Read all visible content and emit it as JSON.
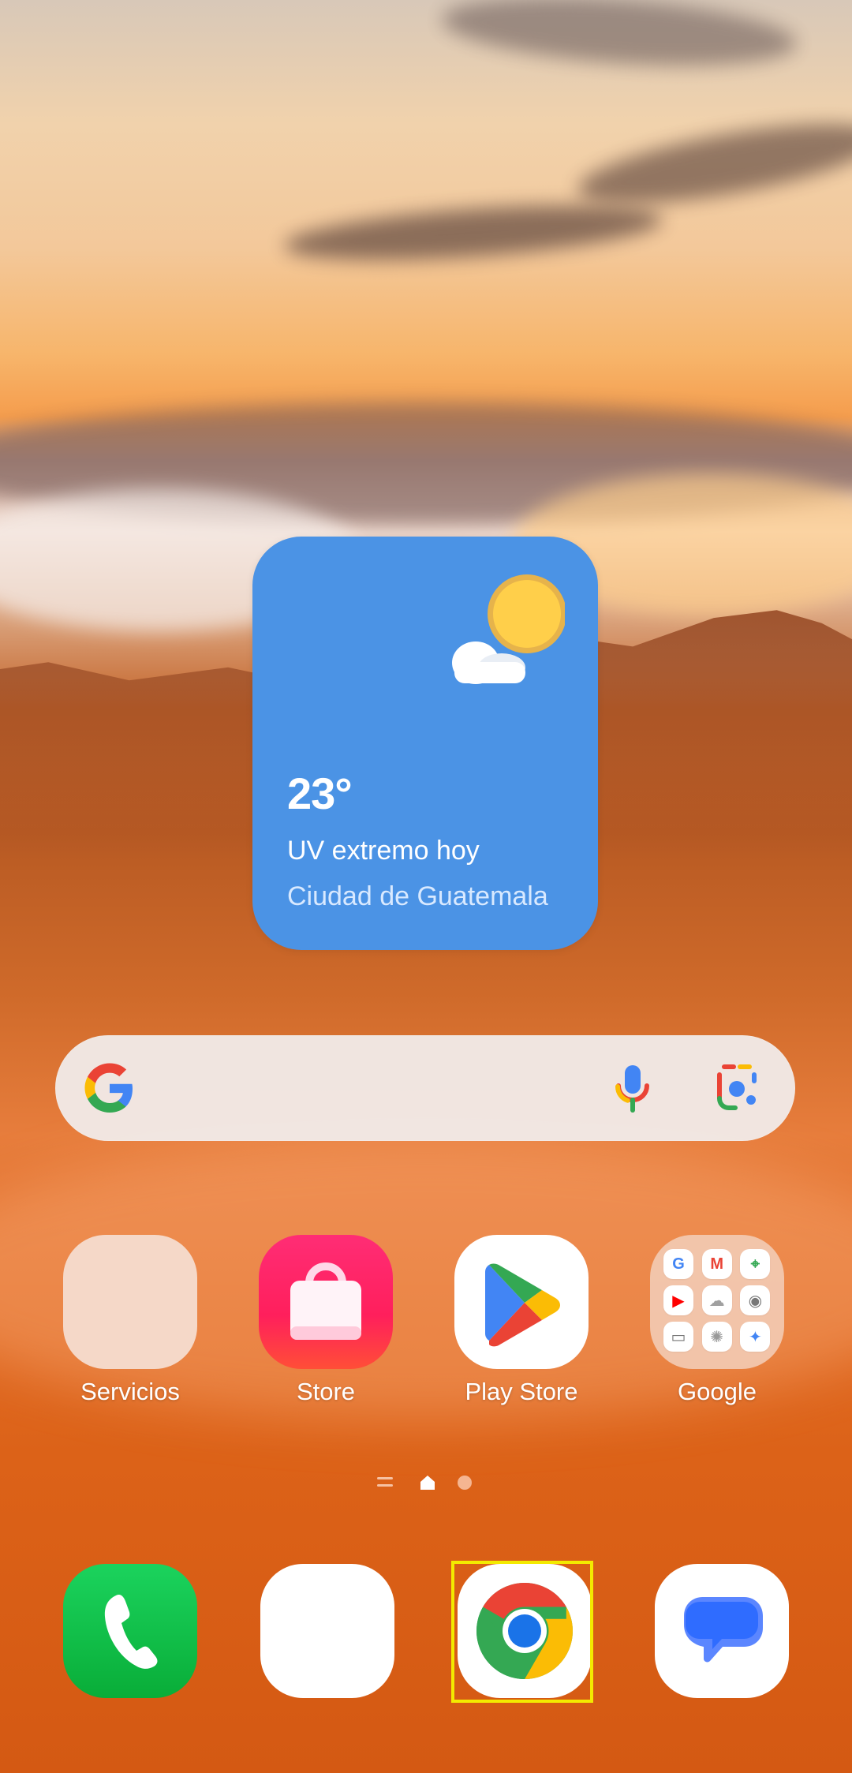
{
  "weather_widget": {
    "temperature": "23°",
    "description": "UV extremo hoy",
    "location": "Ciudad de Guatemala"
  },
  "search_bar": {
    "google_icon": "google-g-icon",
    "voice_icon": "microphone-icon",
    "lens_icon": "google-lens-icon"
  },
  "apps": {
    "servicios": {
      "label": "Servicios"
    },
    "store": {
      "label": "Store"
    },
    "play_store": {
      "label": "Play Store"
    },
    "google": {
      "label": "Google"
    }
  },
  "folder_icons": [
    "google-icon",
    "gmail-icon",
    "maps-icon",
    "youtube-icon",
    "drive-icon",
    "play-movies-icon",
    "tv-icon",
    "photos-icon",
    "gemini-icon"
  ],
  "page_indicator": {
    "icons": [
      "menu-icon",
      "home-icon",
      "page-dot-icon"
    ]
  },
  "dock": {
    "icons": [
      "phone-icon",
      "blank-app-icon",
      "chrome-icon",
      "messages-icon"
    ]
  },
  "colors": {
    "weather_widget": "#4b93e5",
    "highlight": "#f3ea00",
    "search_bar": "#f1eceb"
  }
}
